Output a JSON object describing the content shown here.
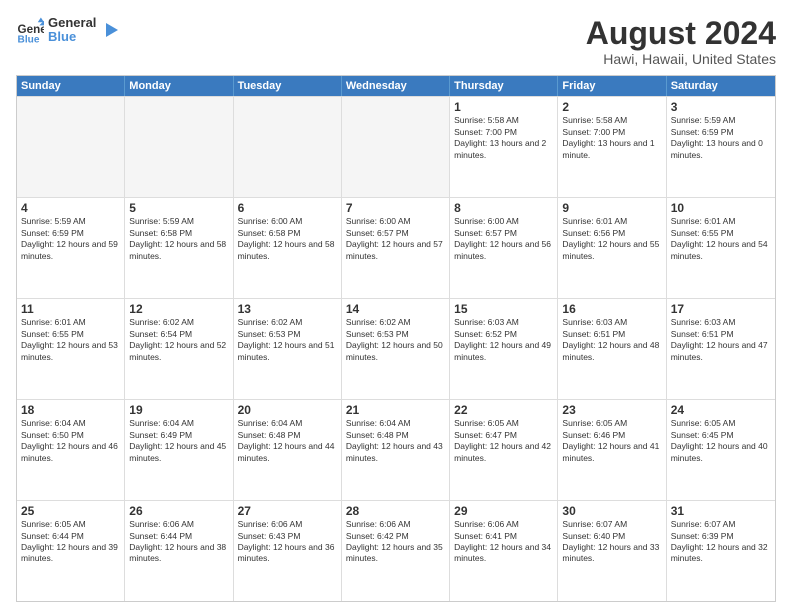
{
  "logo": {
    "line1": "General",
    "line2": "Blue"
  },
  "calendar": {
    "title": "August 2024",
    "subtitle": "Hawi, Hawaii, United States",
    "days_of_week": [
      "Sunday",
      "Monday",
      "Tuesday",
      "Wednesday",
      "Thursday",
      "Friday",
      "Saturday"
    ],
    "weeks": [
      [
        {
          "day": "",
          "empty": true
        },
        {
          "day": "",
          "empty": true
        },
        {
          "day": "",
          "empty": true
        },
        {
          "day": "",
          "empty": true
        },
        {
          "day": "1",
          "sunrise": "5:58 AM",
          "sunset": "7:00 PM",
          "daylight": "13 hours and 2 minutes."
        },
        {
          "day": "2",
          "sunrise": "5:58 AM",
          "sunset": "7:00 PM",
          "daylight": "13 hours and 1 minute."
        },
        {
          "day": "3",
          "sunrise": "5:59 AM",
          "sunset": "6:59 PM",
          "daylight": "13 hours and 0 minutes."
        }
      ],
      [
        {
          "day": "4",
          "sunrise": "5:59 AM",
          "sunset": "6:59 PM",
          "daylight": "12 hours and 59 minutes."
        },
        {
          "day": "5",
          "sunrise": "5:59 AM",
          "sunset": "6:58 PM",
          "daylight": "12 hours and 58 minutes."
        },
        {
          "day": "6",
          "sunrise": "6:00 AM",
          "sunset": "6:58 PM",
          "daylight": "12 hours and 58 minutes."
        },
        {
          "day": "7",
          "sunrise": "6:00 AM",
          "sunset": "6:57 PM",
          "daylight": "12 hours and 57 minutes."
        },
        {
          "day": "8",
          "sunrise": "6:00 AM",
          "sunset": "6:57 PM",
          "daylight": "12 hours and 56 minutes."
        },
        {
          "day": "9",
          "sunrise": "6:01 AM",
          "sunset": "6:56 PM",
          "daylight": "12 hours and 55 minutes."
        },
        {
          "day": "10",
          "sunrise": "6:01 AM",
          "sunset": "6:55 PM",
          "daylight": "12 hours and 54 minutes."
        }
      ],
      [
        {
          "day": "11",
          "sunrise": "6:01 AM",
          "sunset": "6:55 PM",
          "daylight": "12 hours and 53 minutes."
        },
        {
          "day": "12",
          "sunrise": "6:02 AM",
          "sunset": "6:54 PM",
          "daylight": "12 hours and 52 minutes."
        },
        {
          "day": "13",
          "sunrise": "6:02 AM",
          "sunset": "6:53 PM",
          "daylight": "12 hours and 51 minutes."
        },
        {
          "day": "14",
          "sunrise": "6:02 AM",
          "sunset": "6:53 PM",
          "daylight": "12 hours and 50 minutes."
        },
        {
          "day": "15",
          "sunrise": "6:03 AM",
          "sunset": "6:52 PM",
          "daylight": "12 hours and 49 minutes."
        },
        {
          "day": "16",
          "sunrise": "6:03 AM",
          "sunset": "6:51 PM",
          "daylight": "12 hours and 48 minutes."
        },
        {
          "day": "17",
          "sunrise": "6:03 AM",
          "sunset": "6:51 PM",
          "daylight": "12 hours and 47 minutes."
        }
      ],
      [
        {
          "day": "18",
          "sunrise": "6:04 AM",
          "sunset": "6:50 PM",
          "daylight": "12 hours and 46 minutes."
        },
        {
          "day": "19",
          "sunrise": "6:04 AM",
          "sunset": "6:49 PM",
          "daylight": "12 hours and 45 minutes."
        },
        {
          "day": "20",
          "sunrise": "6:04 AM",
          "sunset": "6:48 PM",
          "daylight": "12 hours and 44 minutes."
        },
        {
          "day": "21",
          "sunrise": "6:04 AM",
          "sunset": "6:48 PM",
          "daylight": "12 hours and 43 minutes."
        },
        {
          "day": "22",
          "sunrise": "6:05 AM",
          "sunset": "6:47 PM",
          "daylight": "12 hours and 42 minutes."
        },
        {
          "day": "23",
          "sunrise": "6:05 AM",
          "sunset": "6:46 PM",
          "daylight": "12 hours and 41 minutes."
        },
        {
          "day": "24",
          "sunrise": "6:05 AM",
          "sunset": "6:45 PM",
          "daylight": "12 hours and 40 minutes."
        }
      ],
      [
        {
          "day": "25",
          "sunrise": "6:05 AM",
          "sunset": "6:44 PM",
          "daylight": "12 hours and 39 minutes."
        },
        {
          "day": "26",
          "sunrise": "6:06 AM",
          "sunset": "6:44 PM",
          "daylight": "12 hours and 38 minutes."
        },
        {
          "day": "27",
          "sunrise": "6:06 AM",
          "sunset": "6:43 PM",
          "daylight": "12 hours and 36 minutes."
        },
        {
          "day": "28",
          "sunrise": "6:06 AM",
          "sunset": "6:42 PM",
          "daylight": "12 hours and 35 minutes."
        },
        {
          "day": "29",
          "sunrise": "6:06 AM",
          "sunset": "6:41 PM",
          "daylight": "12 hours and 34 minutes."
        },
        {
          "day": "30",
          "sunrise": "6:07 AM",
          "sunset": "6:40 PM",
          "daylight": "12 hours and 33 minutes."
        },
        {
          "day": "31",
          "sunrise": "6:07 AM",
          "sunset": "6:39 PM",
          "daylight": "12 hours and 32 minutes."
        }
      ]
    ]
  }
}
